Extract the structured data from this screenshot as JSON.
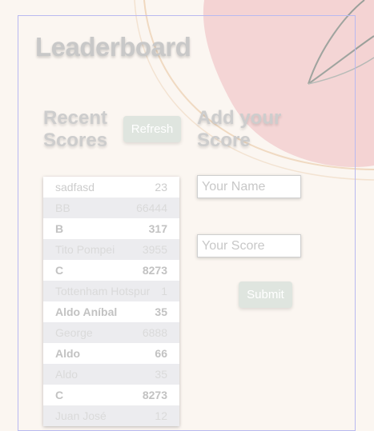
{
  "page": {
    "title": "Leaderboard"
  },
  "recent": {
    "heading_line1": "Recent",
    "heading_line2": "Scores",
    "refresh_label": "Refresh",
    "rows": [
      {
        "name": "sadfasd",
        "score": "23"
      },
      {
        "name": "BB",
        "score": "66444"
      },
      {
        "name": "B",
        "score": "317"
      },
      {
        "name": "Tito Pompei",
        "score": "3955"
      },
      {
        "name": "C",
        "score": "8273"
      },
      {
        "name": "Tottenham Hotspur",
        "score": "1"
      },
      {
        "name": "Aldo Aníbal",
        "score": "35"
      },
      {
        "name": "George",
        "score": "6888"
      },
      {
        "name": "Aldo",
        "score": "66"
      },
      {
        "name": "Aldo",
        "score": "35"
      },
      {
        "name": "C",
        "score": "8273"
      },
      {
        "name": "Juan José",
        "score": "12"
      }
    ]
  },
  "add": {
    "heading_line1": "Add your",
    "heading_line2": "Score",
    "name_placeholder": "Your Name",
    "score_placeholder": "Your Score",
    "submit_label": "Submit"
  },
  "colors": {
    "blob": "#f4d3d3",
    "panel_border": "#b9b9f0",
    "button_bg": "#dfe5df"
  }
}
